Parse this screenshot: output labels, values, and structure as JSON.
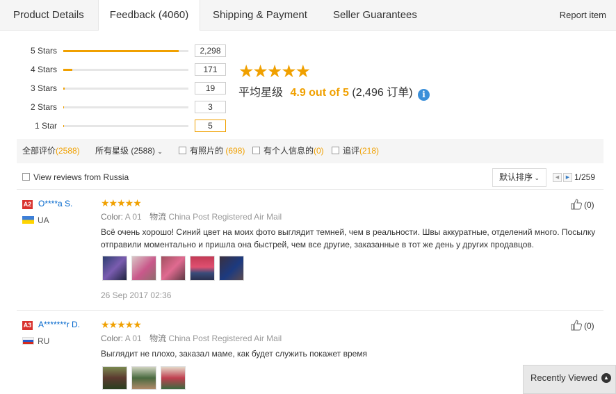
{
  "tabs": [
    {
      "label": "Product Details"
    },
    {
      "label": "Feedback (4060)"
    },
    {
      "label": "Shipping & Payment"
    },
    {
      "label": "Seller Guarantees"
    }
  ],
  "report_item": "Report item",
  "histogram": [
    {
      "label": "5 Stars",
      "count": "2,298",
      "fraction": 0.92
    },
    {
      "label": "4 Stars",
      "count": "171",
      "fraction": 0.07
    },
    {
      "label": "3 Stars",
      "count": "19",
      "fraction": 0.01
    },
    {
      "label": "2 Stars",
      "count": "3",
      "fraction": 0.0
    },
    {
      "label": "1 Star",
      "count": "5",
      "fraction": 0.0
    }
  ],
  "summary": {
    "stars": "★★★★★",
    "prefix": "平均星级",
    "score": "4.9 out of 5",
    "orders": "(2,496 订单)",
    "info_glyph": "i"
  },
  "filters": {
    "all_label": "全部评价",
    "all_count": "(2588)",
    "star_select": "所有星级 (2588)",
    "photo_label": "有照片的",
    "photo_count": "(698)",
    "personal_label": "有个人信息的",
    "personal_count": "(0)",
    "followup_label": "追评",
    "followup_count": "(218)"
  },
  "russia_label": "View reviews from Russia",
  "sort_label": "默认排序",
  "pagination": "1/259",
  "reviews": [
    {
      "badge": "A2",
      "name": "O****a S.",
      "country": "UA",
      "stars": "★★★★★",
      "color_label": "Color:",
      "color_value": "A 01",
      "logistics_label": "物流",
      "logistics_value": "China Post Registered Air Mail",
      "text": "Всё очень хорошо! Синий цвет на моих фото выглядит темней, чем в реальности. Швы аккуратные, отделений много. Посылку отправили моментально и пришла она быстрей, чем все другие, заказанные в тот же день у других продавцов.",
      "date": "26 Sep 2017 02:36",
      "helpful": "(0)"
    },
    {
      "badge": "A3",
      "name": "A*******r D.",
      "country": "RU",
      "stars": "★★★★★",
      "color_label": "Color:",
      "color_value": "A 01",
      "logistics_label": "物流",
      "logistics_value": "China Post Registered Air Mail",
      "text": "Выглядит не плохо, заказал маме, как будет служить покажет время",
      "helpful": "(0)"
    }
  ],
  "recently_viewed": "Recently Viewed",
  "colors": {
    "accent": "#f0a000",
    "link": "#0066cc",
    "badge": "#d9322e"
  }
}
